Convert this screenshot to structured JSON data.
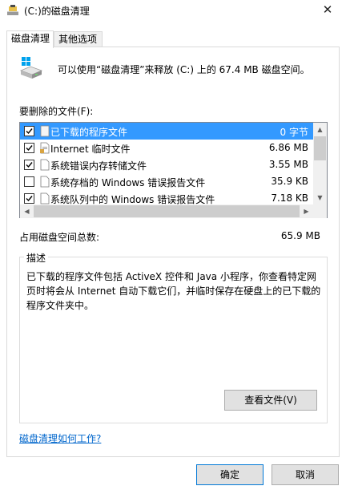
{
  "window": {
    "title": "(C:)的磁盘清理",
    "close_glyph": "✕"
  },
  "tabs": [
    {
      "label": "磁盘清理",
      "active": true
    },
    {
      "label": "其他选项",
      "active": false
    }
  ],
  "summary": {
    "text": "可以使用“磁盘清理”来释放  (C:) 上的 67.4 MB 磁盘空间。",
    "icon": "disk-cleanup-icon"
  },
  "files_label": "要删除的文件(F):",
  "files": [
    {
      "name": "已下载的程序文件",
      "size": "0 字节",
      "checked": true,
      "selected": true,
      "icon": "folder-icon"
    },
    {
      "name": "Internet 临时文件",
      "size": "6.86 MB",
      "checked": true,
      "selected": false,
      "icon": "document-lock-icon"
    },
    {
      "name": "系统错误内存转储文件",
      "size": "3.55 MB",
      "checked": true,
      "selected": false,
      "icon": "document-icon"
    },
    {
      "name": "系统存档的 Windows 错误报告文件",
      "size": "35.9 KB",
      "checked": false,
      "selected": false,
      "icon": "document-icon"
    },
    {
      "name": "系统队列中的 Windows 错误报告文件",
      "size": "7.18 KB",
      "checked": true,
      "selected": false,
      "icon": "document-icon"
    }
  ],
  "total": {
    "label": "占用磁盘空间总数:",
    "value": "65.9 MB"
  },
  "description": {
    "title": "描述",
    "text": "已下载的程序文件包括 ActiveX 控件和 Java 小程序，你查看特定网页时将会从 Internet 自动下载它们，并临时保存在硬盘上的已下载的程序文件夹中。"
  },
  "buttons": {
    "view_files": "查看文件(V)",
    "ok": "确定",
    "cancel": "取消"
  },
  "help_link": "磁盘清理如何工作?",
  "colors": {
    "selection": "#3399ff",
    "link": "#0066cc",
    "accent": "#0078d7"
  }
}
